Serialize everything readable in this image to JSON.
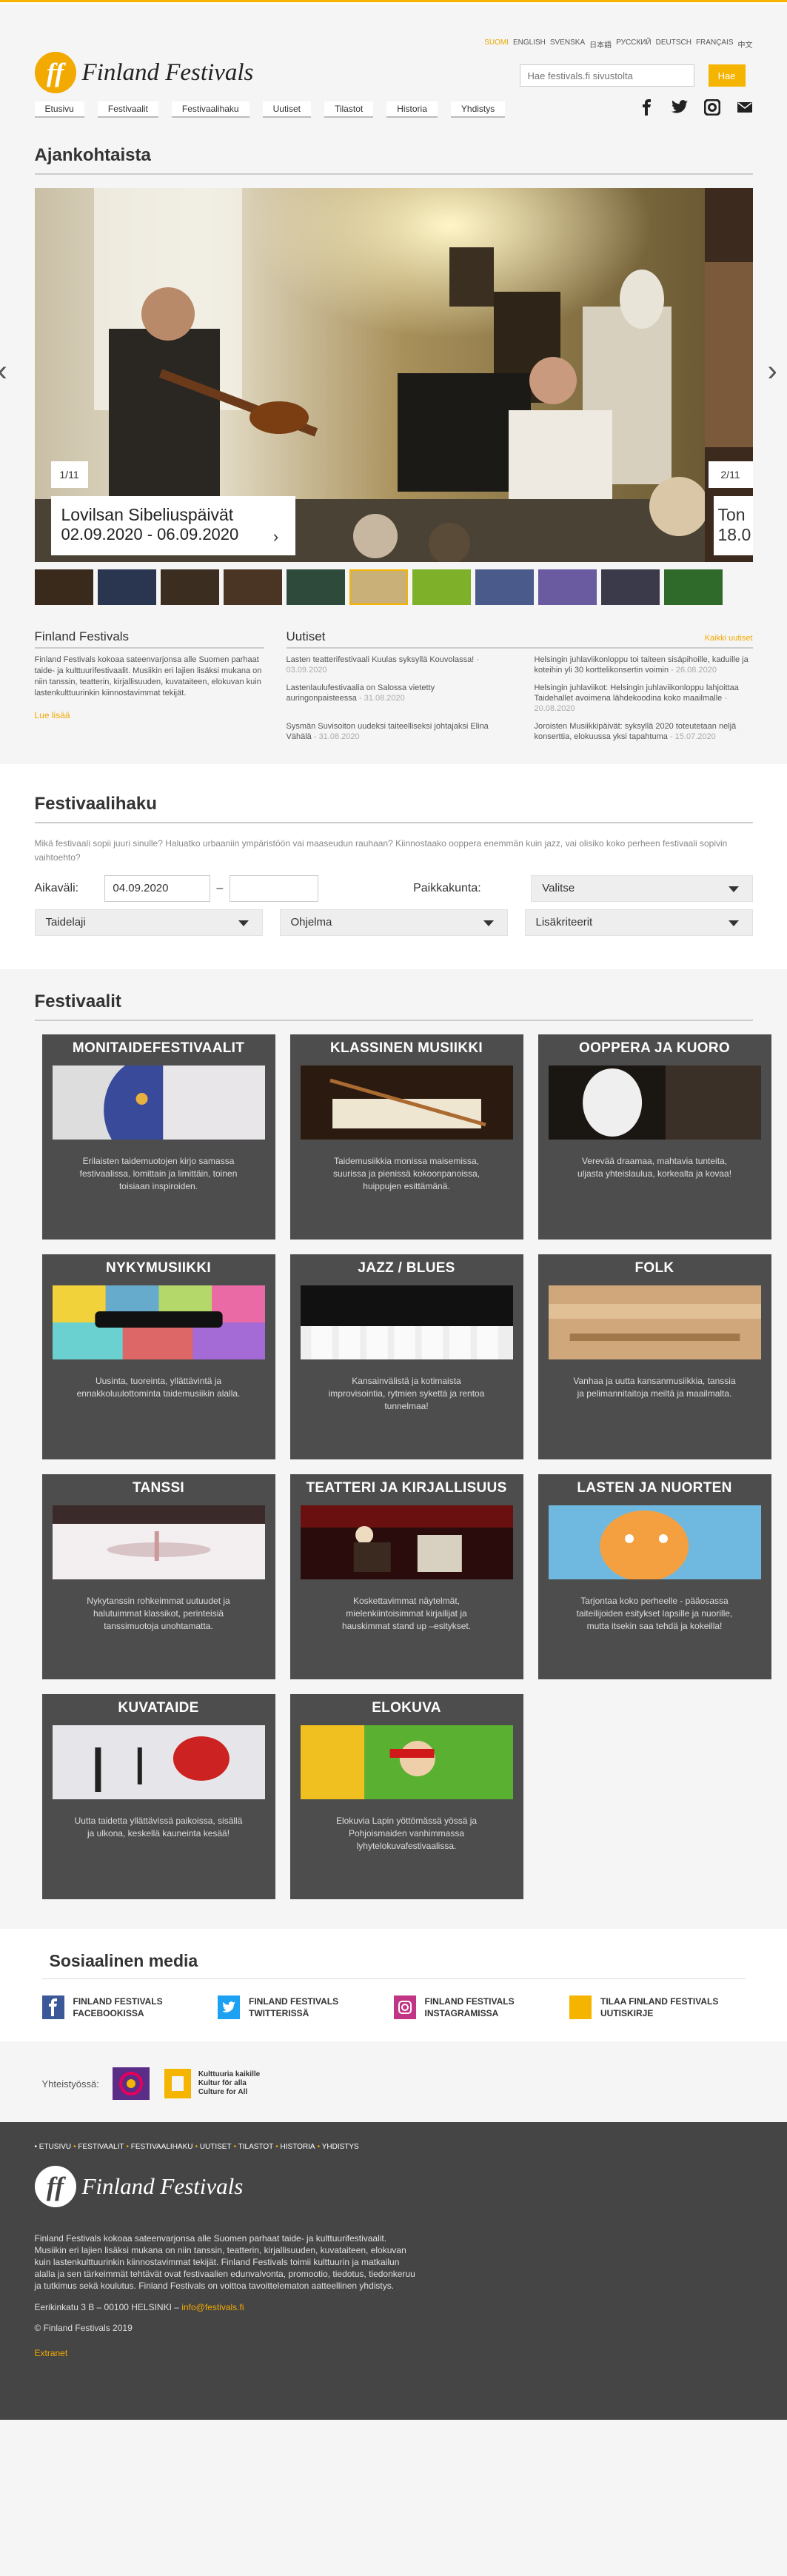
{
  "languages": [
    "SUOMI",
    "ENGLISH",
    "SVENSKA",
    "日本語",
    "РУССКИЙ",
    "DEUTSCH",
    "FRANÇAIS",
    "中文"
  ],
  "brand": {
    "logo_mark": "ff",
    "name": "Finland Festivals"
  },
  "search": {
    "placeholder": "Hae festivals.fi sivustolta",
    "button": "Hae"
  },
  "nav": [
    "Etusivu",
    "Festivaalit",
    "Festivaalihaku",
    "Uutiset",
    "Tilastot",
    "Historia",
    "Yhdistys"
  ],
  "social_icons": [
    "facebook-icon",
    "twitter-icon",
    "instagram-icon",
    "email-icon"
  ],
  "current": {
    "title": "Ajankohtaista",
    "slide": {
      "counter": "1/11",
      "title": "Lovilsan Sibeliuspäivät",
      "dates": "02.09.2020 - 06.09.2020"
    },
    "next_slide": {
      "counter": "2/11",
      "title": "Ton",
      "dates": "18.0"
    },
    "thumb_count": 11,
    "active_thumb": 6
  },
  "about": {
    "title": "Finland Festivals",
    "text": "Finland Festivals kokoaa sateenvarjonsa alle Suomen parhaat taide- ja kulttuurifestivaalit. Musiikin eri lajien lisäksi mukana on niin tanssin, teatterin, kirjallisuuden, kuvataiteen, elokuvan kuin lastenkulttuurinkin kiinnostavimmat tekijät.",
    "read_more": "Lue lisää"
  },
  "news": {
    "title": "Uutiset",
    "all": "Kaikki uutiset",
    "items": [
      {
        "text": "Lasten teatterifestivaali Kuulas syksyllä Kouvolassa!",
        "date": "03.09.2020"
      },
      {
        "text": "Helsingin juhlaviikonloppu toi taiteen sisäpihoille, kaduille ja koteihin yli 30 korttelikonsertin voimin",
        "date": "26.08.2020"
      },
      {
        "text": "Lastenlaulufestivaalia on Salossa vietetty auringonpaisteessa",
        "date": "31.08.2020"
      },
      {
        "text": "Helsingin juhlaviikot: Helsingin juhlaviikonloppu lahjoittaa Taidehallet avoimena lähdekoodina koko maailmalle",
        "date": "20.08.2020"
      },
      {
        "text": "Sysmän Suvisoiton uudeksi taiteelliseksi johtajaksi Elina Vähälä",
        "date": "31.08.2020"
      },
      {
        "text": "Joroisten Musiikkipäivät: syksyllä 2020 toteutetaan neljä konserttia, elokuussa yksi tapahtuma",
        "date": "15.07.2020"
      }
    ]
  },
  "festival_search": {
    "title": "Festivaalihaku",
    "intro": "Mikä festivaali sopii juuri sinulle? Haluatko urbaaniin ympäristöön vai maaseudun rauhaan? Kiinnostaako ooppera enemmän kuin jazz, vai olisiko koko perheen festivaali sopivin vaihtoehto?",
    "start_label": "Aikaväli:",
    "start_value": "04.09.2020",
    "dash": "–",
    "end_value": "",
    "city_label": "Paikkakunta:",
    "city_value": "Valitse",
    "art_value": "Taidelaji",
    "program_value": "Ohjelma",
    "more_filters": "Lisäkriteerit"
  },
  "festivals": {
    "title": "Festivaalit",
    "cards": [
      {
        "title": "MONITAIDEFESTIVAALIT",
        "desc": "Erilaisten taidemuotojen kirjo samassa festivaalissa, lomittain ja limittäin, toinen toisiaan inspiroiden."
      },
      {
        "title": "KLASSINEN MUSIIKKI",
        "desc": "Taidemusiikkia monissa maisemissa, suurissa ja pienissä kokoonpanoissa, huippujen esittämänä."
      },
      {
        "title": "OOPPERA JA KUORO",
        "desc": "Verevää draamaa, mahtavia tunteita, uljasta yhteislaulua, korkealta ja kovaa!"
      },
      {
        "title": "NYKYMUSIIKKI",
        "desc": "Uusinta, tuoreinta, yllättävintä ja ennakkoluulottominta taidemusiikin alalla."
      },
      {
        "title": "JAZZ / BLUES",
        "desc": "Kansainvälistä ja kotimaista improvisointia, rytmien sykettä ja rentoa tunnelmaa!"
      },
      {
        "title": "FOLK",
        "desc": "Vanhaa ja uutta kansanmusiikkia, tanssia ja pelimannitaitoja meiltä ja maailmalta."
      },
      {
        "title": "TANSSI",
        "desc": "Nykytanssin rohkeimmat uutuudet ja halutuimmat klassikot, perinteisiä tanssimuotoja unohtamatta."
      },
      {
        "title": "TEATTERI JA KIRJALLISUUS",
        "desc": "Koskettavimmat näytelmät, mielenkiintoisimmat kirjailijat ja hauskimmat stand up –esitykset."
      },
      {
        "title": "LASTEN JA NUORTEN",
        "desc": "Tarjontaa koko perheelle - pääosassa taiteilijoiden esitykset lapsille ja nuorille, mutta itsekin saa tehdä ja kokeilla!"
      },
      {
        "title": "KUVATAIDE",
        "desc": "Uutta taidetta yllättävissä paikoissa, sisällä ja ulkona, keskellä kauneinta kesää!"
      },
      {
        "title": "ELOKUVA",
        "desc": "Elokuvia Lapin yöttömässä yössä ja Pohjoismaiden vanhimmassa lyhytelokuvafestivaalissa."
      }
    ]
  },
  "social_media": {
    "title": "Sosiaalinen media",
    "items": [
      {
        "label": "FINLAND FESTIVALS FACEBOOKISSA",
        "icon": "facebook-icon",
        "color": "#3b5998"
      },
      {
        "label": "FINLAND FESTIVALS TWITTERISSÄ",
        "icon": "twitter-icon",
        "color": "#1da1f2"
      },
      {
        "label": "FINLAND FESTIVALS INSTAGRAMISSA",
        "icon": "instagram-icon",
        "color": "#c13584"
      },
      {
        "label": "TILAA FINLAND FESTIVALS UUTISKIRJE",
        "icon": "newsletter-icon",
        "color": "#f5b400"
      }
    ]
  },
  "partners": {
    "label": "Yhteistyössä:",
    "culture_line1": "Kulttuuria kaikille",
    "culture_line2": "Kultur för alla",
    "culture_line3": "Culture for All"
  },
  "footer": {
    "nav": [
      "ETUSIVU",
      "FESTIVAALIT",
      "FESTIVAALIHAKU",
      "UUTISET",
      "TILASTOT",
      "HISTORIA",
      "YHDISTYS"
    ],
    "text": "Finland Festivals kokoaa sateenvarjonsa alle Suomen parhaat taide- ja kulttuurifestivaalit. Musiikin eri lajien lisäksi mukana on niin tanssin, teatterin, kirjallisuuden, kuvataiteen, elokuvan kuin lastenkulttuurinkin kiinnostavimmat tekijät. Finland Festivals toimii kulttuurin ja matkailun alalla ja sen tärkeimmät tehtävät ovat festivaalien edunvalvonta, promootio, tiedotus, tiedonkeruu ja tutkimus sekä koulutus. Finland Festivals on voittoa tavoittelematon aatteellinen yhdistys.",
    "address": "Eerikinkatu 3 B – 00100 HELSINKI –",
    "email": "info@festivals.fi",
    "copyright": "© Finland Festivals 2019",
    "extranet": "Extranet"
  },
  "colors": {
    "accent": "#f5b400",
    "card_bg": "#4d4d4d",
    "footer_bg": "#454545"
  }
}
